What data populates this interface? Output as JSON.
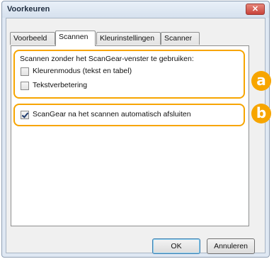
{
  "window": {
    "title": "Voorkeuren",
    "close_glyph": "✕"
  },
  "tabs": [
    {
      "label": "Voorbeeld",
      "active": false
    },
    {
      "label": "Scannen",
      "active": true
    },
    {
      "label": "Kleurinstellingen",
      "active": false
    },
    {
      "label": "Scanner",
      "active": false
    }
  ],
  "group_a": {
    "heading": "Scannen zonder het ScanGear-venster te gebruiken:",
    "options": [
      {
        "label": "Kleurenmodus (tekst en tabel)",
        "checked": false
      },
      {
        "label": "Tekstverbetering",
        "checked": false
      }
    ],
    "badge": "a"
  },
  "group_b": {
    "option": {
      "label": "ScanGear na het scannen automatisch afsluiten",
      "checked": true
    },
    "badge": "b"
  },
  "buttons": {
    "ok": "OK",
    "cancel": "Annuleren"
  },
  "colors": {
    "highlight": "#f7a500"
  }
}
